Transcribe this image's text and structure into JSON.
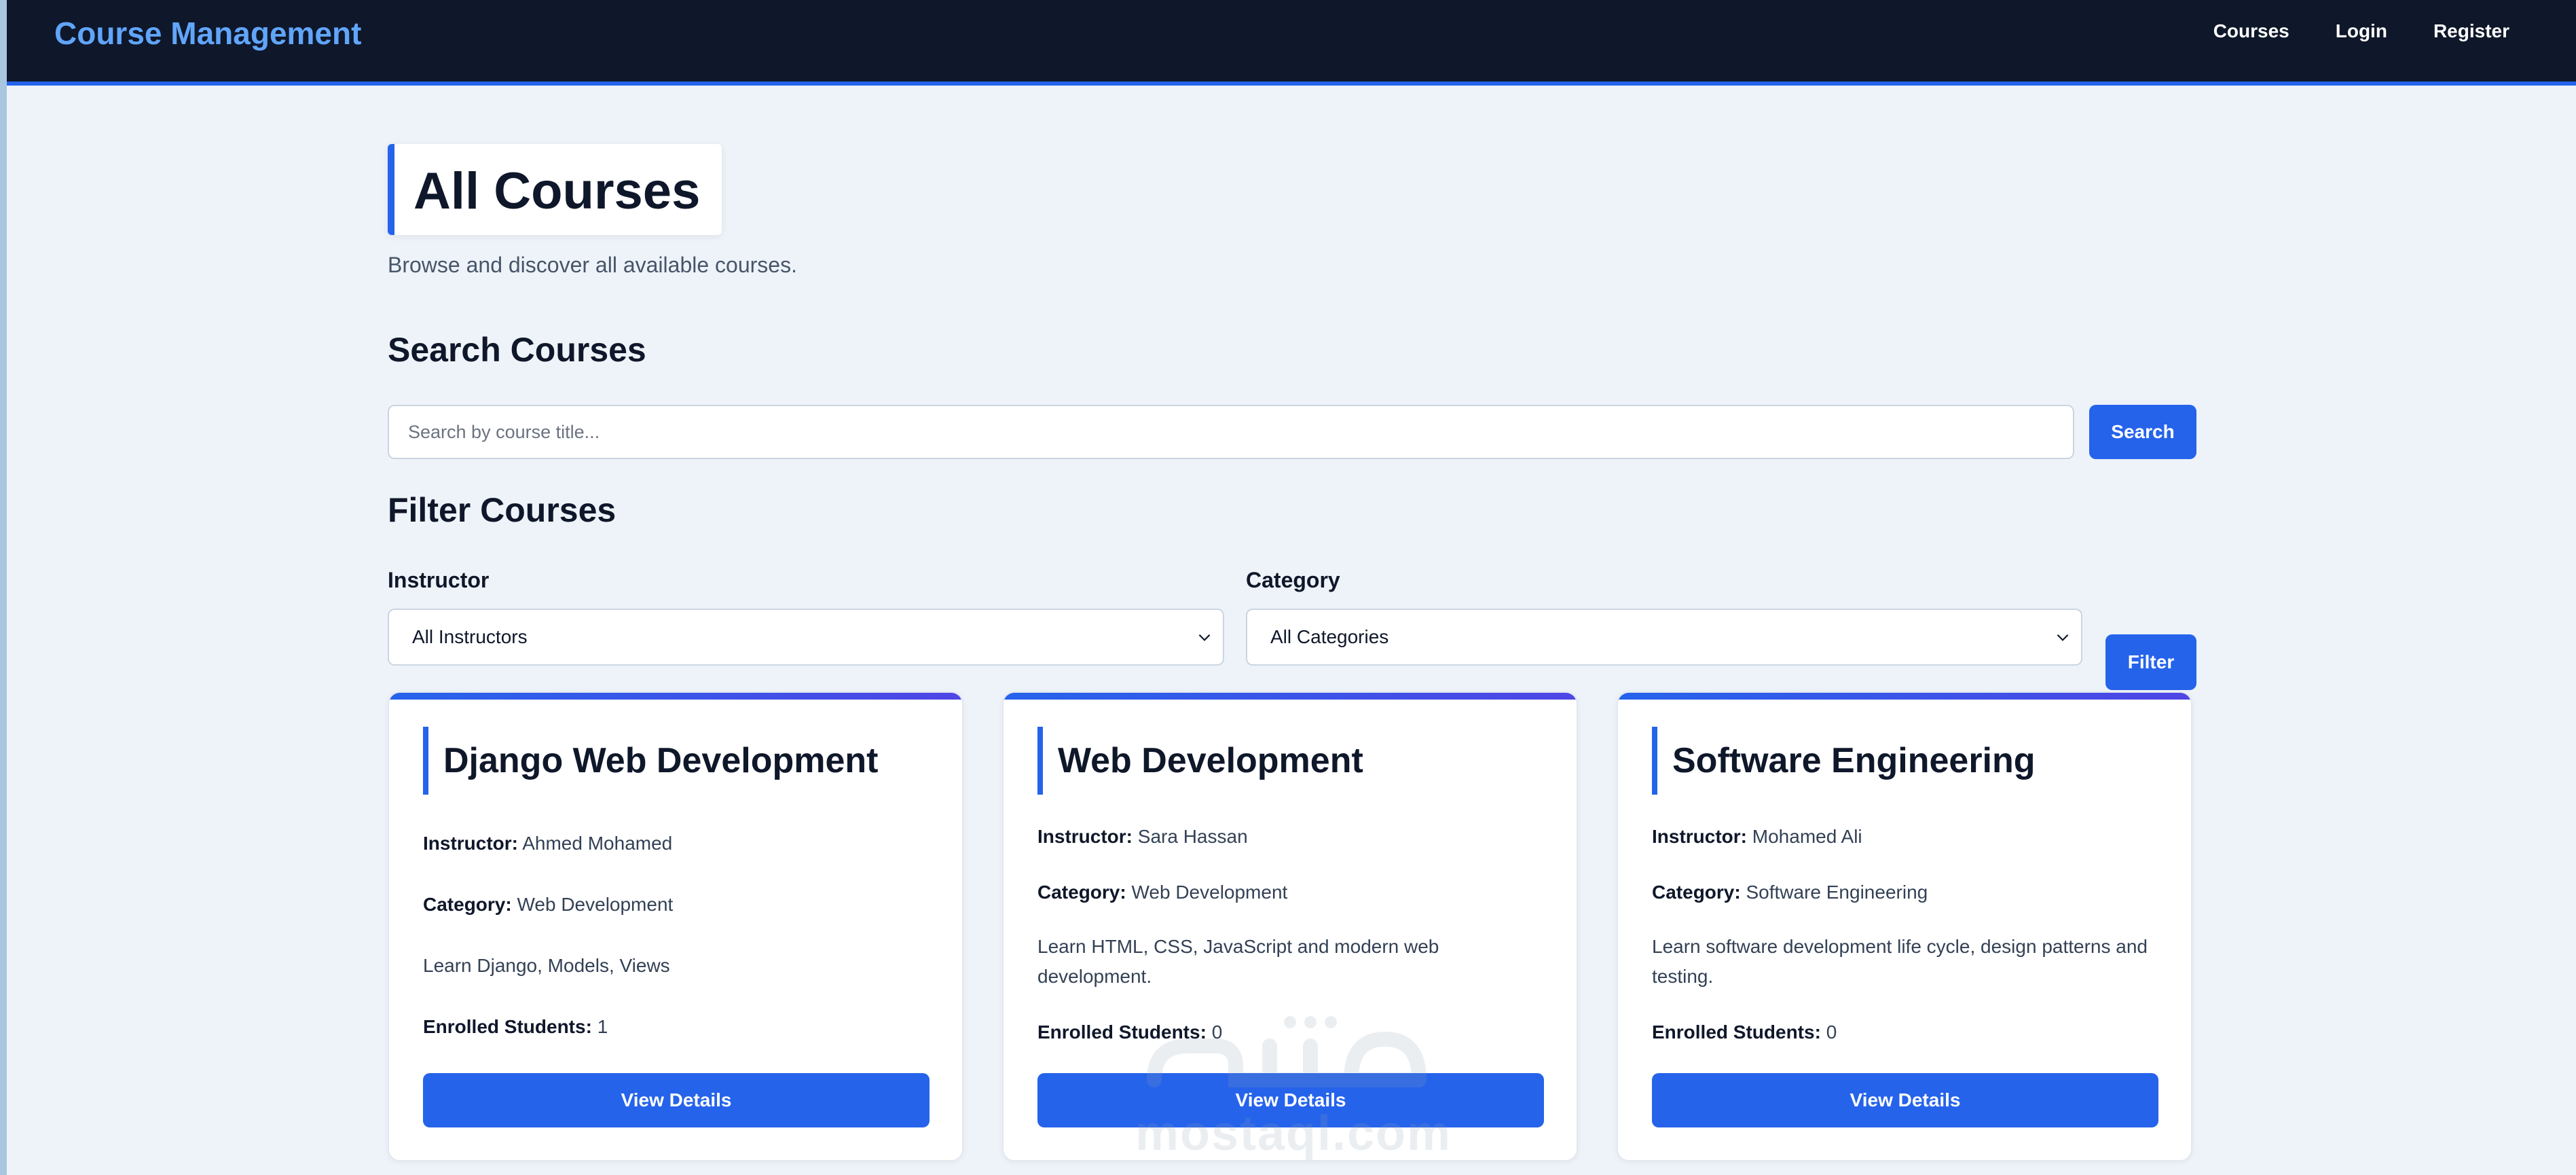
{
  "navbar": {
    "brand": "Course Management",
    "links": [
      "Courses",
      "Login",
      "Register"
    ]
  },
  "header": {
    "title": "All Courses",
    "subtitle": "Browse and discover all available courses."
  },
  "search": {
    "heading": "Search Courses",
    "placeholder": "Search by course title...",
    "value": "",
    "button": "Search"
  },
  "filter": {
    "heading": "Filter Courses",
    "instructor_label": "Instructor",
    "instructor_value": "All Instructors",
    "category_label": "Category",
    "category_value": "All Categories",
    "button": "Filter"
  },
  "labels": {
    "instructor": "Instructor:",
    "category": "Category:",
    "enrolled": "Enrolled Students:",
    "view": "View Details"
  },
  "courses": [
    {
      "title": "Django Web Development",
      "instructor": "Ahmed Mohamed",
      "category": "Web Development",
      "description": "Learn Django, Models, Views",
      "enrolled": "1"
    },
    {
      "title": "Web Development",
      "instructor": "Sara Hassan",
      "category": "Web Development",
      "description": "Learn HTML, CSS, JavaScript and modern web development.",
      "enrolled": "0"
    },
    {
      "title": "Software Engineering",
      "instructor": "Mohamed Ali",
      "category": "Software Engineering",
      "description": "Learn software development life cycle, design patterns and testing.",
      "enrolled": "0"
    }
  ],
  "watermark": {
    "text": "mostaql.com"
  },
  "colors": {
    "navbar_bg": "#0f172a",
    "brand": "#60a5fa",
    "accent": "#2563eb",
    "page_bg": "#eef3f9"
  }
}
